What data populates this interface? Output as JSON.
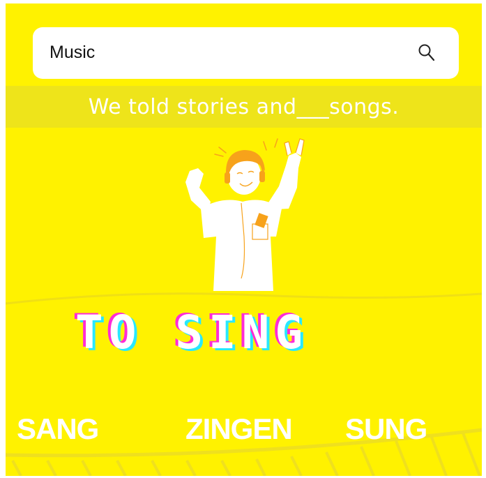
{
  "search": {
    "value": "Music",
    "icon": "search-icon"
  },
  "prompt": {
    "sentence": "We told stories and___songs."
  },
  "illustration": {
    "icon": "singer-illustration"
  },
  "verb": {
    "title": "TO SING"
  },
  "options": [
    {
      "label": "SANG"
    },
    {
      "label": "ZINGEN"
    },
    {
      "label": "SUNG"
    }
  ],
  "colors": {
    "background": "#fff200",
    "band": "#eee41a",
    "illustration_accent": "#f7a21b",
    "title_shadow_magenta": "#ff2bd6",
    "title_shadow_cyan": "#29e8ff",
    "text": "#ffffff"
  }
}
